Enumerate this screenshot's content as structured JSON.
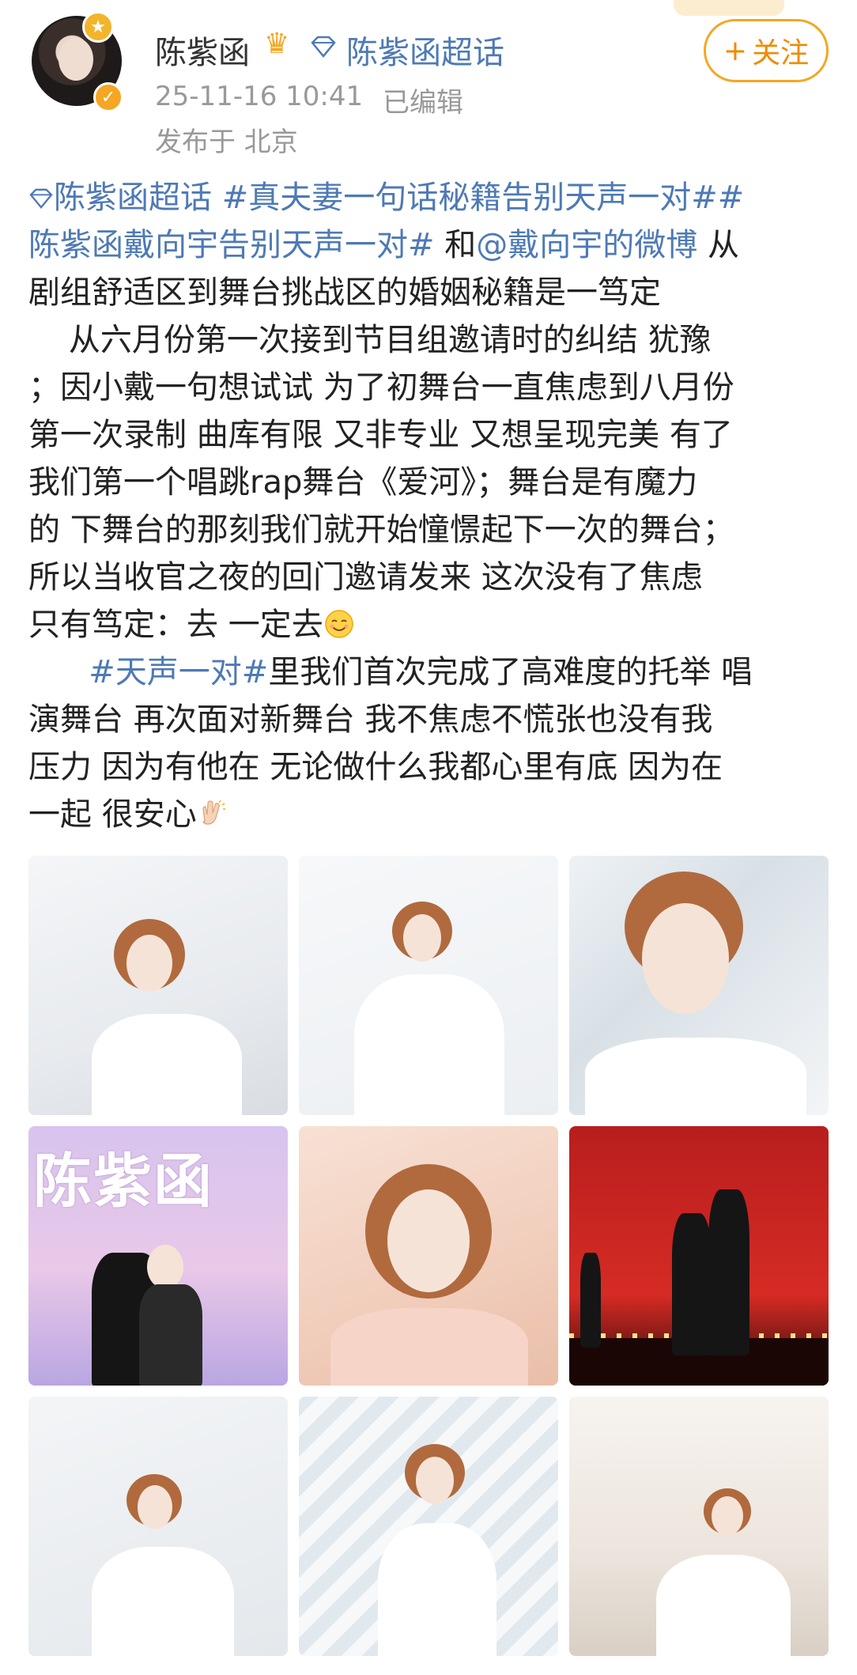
{
  "header": {
    "username": "陈紫函",
    "supertopic_label": "陈紫函超话",
    "timestamp": "25-11-16 10:41",
    "edited_label": "已编辑",
    "location": "发布于 北京",
    "follow_label": "关注",
    "follow_plus": "+"
  },
  "post": {
    "line1_topic1": "陈紫函超话",
    "line1_topic2": "#真夫妻一句话秘籍告别天声一对#",
    "line1_topic3": "#",
    "line2_topic": "陈紫函戴向宇告别天声一对#",
    "line2_and": " 和",
    "line2_mention": "@戴向宇的微博",
    "line2_rest": " 从",
    "line3": "剧组舒适区到舞台挑战区的婚姻秘籍是一笃定",
    "line4": "    从六月份第一次接到节目组邀请时的纠结 犹豫",
    "line5": "；因小戴一句想试试 为了初舞台一直焦虑到八月份",
    "line6": "第一次录制 曲库有限 又非专业 又想呈现完美 有了",
    "line7": "我们第一个唱跳rap舞台《爱河》；舞台是有魔力",
    "line8": "的 下舞台的那刻我们就开始憧憬起下一次的舞台；",
    "line9": "所以当收官之夜的回门邀请发来 这次没有了焦虑",
    "line10": "只有笃定：去 一定去",
    "line11_indent": "      ",
    "line11_topic": "#天声一对#",
    "line11_rest": "里我们首次完成了高难度的托举 唱",
    "line12": "演舞台 再次面对新舞台 我不焦虑不慌张也没有我",
    "line13": "压力 因为有他在 无论做什么我都心里有底 因为在",
    "line14": "一起 很安心"
  },
  "photos": {
    "p4_overlay": "陈紫函"
  },
  "colors": {
    "link": "#4e7ab5",
    "follow_accent": "#f5a623",
    "meta_text": "#999999"
  },
  "icons": [
    "crown-icon",
    "diamond-icon",
    "verified-icon",
    "smile-emoji-icon",
    "clap-emoji-icon"
  ]
}
